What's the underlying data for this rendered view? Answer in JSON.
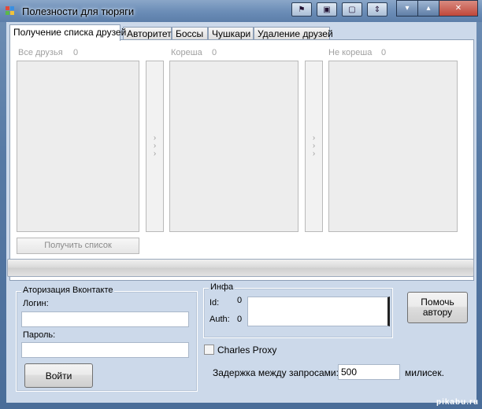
{
  "window": {
    "title": "Полезности для тюряги"
  },
  "tabs": [
    {
      "label": "Получение списка друзей",
      "active": true
    },
    {
      "label": "Авторитет",
      "active": false
    },
    {
      "label": "Боссы",
      "active": false
    },
    {
      "label": "Чушкари",
      "active": false
    },
    {
      "label": "Удаление друзей",
      "active": false
    }
  ],
  "friends": {
    "all_label": "Все друзья",
    "all_count": "0",
    "koresha_label": "Кореша",
    "koresha_count": "0",
    "ne_koresha_label": "Не кореша",
    "ne_koresha_count": "0",
    "move_glyph": "›",
    "get_list_button": "Получить список"
  },
  "progress": {
    "value": 0
  },
  "auth": {
    "group_title": "Аторизация Вконтакте",
    "login_label": "Логин:",
    "login_value": "",
    "password_label": "Пароль:",
    "password_value": "",
    "login_button": "Войти"
  },
  "info": {
    "group_title": "Инфа",
    "id_label": "Id:",
    "id_value": "0",
    "auth_label": "Auth:",
    "auth_value": "0",
    "notes_value": ""
  },
  "help_button": "Помочь\nавтору",
  "charles": {
    "label": "Charles Proxy",
    "checked": false
  },
  "delay": {
    "label": "Задержка между запросами:",
    "value": "500",
    "unit": "милисек."
  },
  "watermark": "pikabu.ru"
}
